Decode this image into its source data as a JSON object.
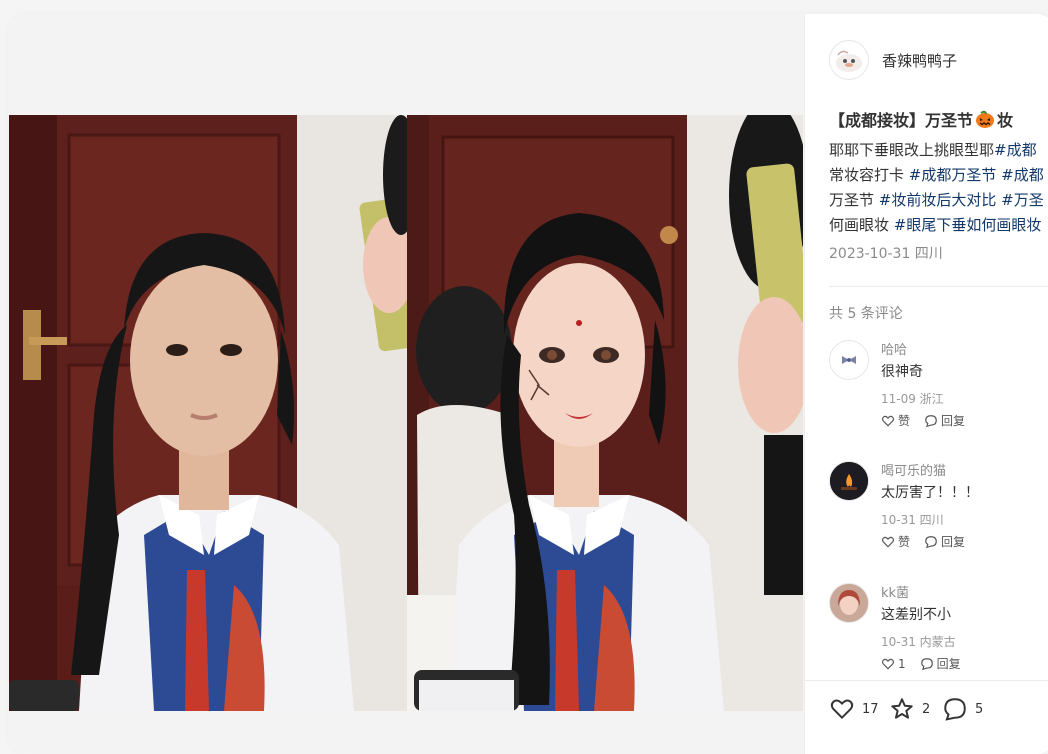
{
  "author": {
    "name": "香辣鸭鸭子",
    "avatar_icon": "cartoon-duck-avatar-icon"
  },
  "note": {
    "title_before": "【成都接妆】万圣节",
    "title_emoji_icon": "pumpkin-emoji-icon",
    "title_after": "妆",
    "desc_line1_text": "耶耶下垂眼改上挑眼型耶",
    "desc_line1_tag": "#成都",
    "desc_line2_text": "常妆容打卡 ",
    "desc_line2_tag1": "#成都万圣节",
    "desc_line2_tag2": "#成都",
    "desc_line3_text": "万圣节 ",
    "desc_line3_tag1": "#妆前妆后大对比",
    "desc_line3_tag2": "#万圣",
    "desc_line4_text": "何画眼妆 ",
    "desc_line4_tag": "#眼尾下垂如何画眼妆",
    "date_location": "2023-10-31 四川",
    "tag_color": "#13386c"
  },
  "comments_header": "共 5 条评论",
  "comments": [
    {
      "user": "哈哈",
      "text": "很神奇",
      "meta": "11-09 浙江",
      "like_label": "赞",
      "reply_label": "回复",
      "avatar_icon": "bow-avatar-icon"
    },
    {
      "user": "喝可乐的猫",
      "text": "太厉害了！！！",
      "meta": "10-31 四川",
      "like_label": "赞",
      "reply_label": "回复",
      "avatar_icon": "campfire-avatar-icon"
    },
    {
      "user": "kk菌",
      "text": "这差别不小",
      "meta": "10-31 内蒙古",
      "like_label": "1",
      "reply_label": "回复",
      "avatar_icon": "girl-portrait-avatar-icon"
    }
  ],
  "engagement": {
    "likes": "17",
    "collects": "2",
    "comments": "5"
  },
  "image": {
    "description_icon": "before-after-makeup-photo"
  }
}
